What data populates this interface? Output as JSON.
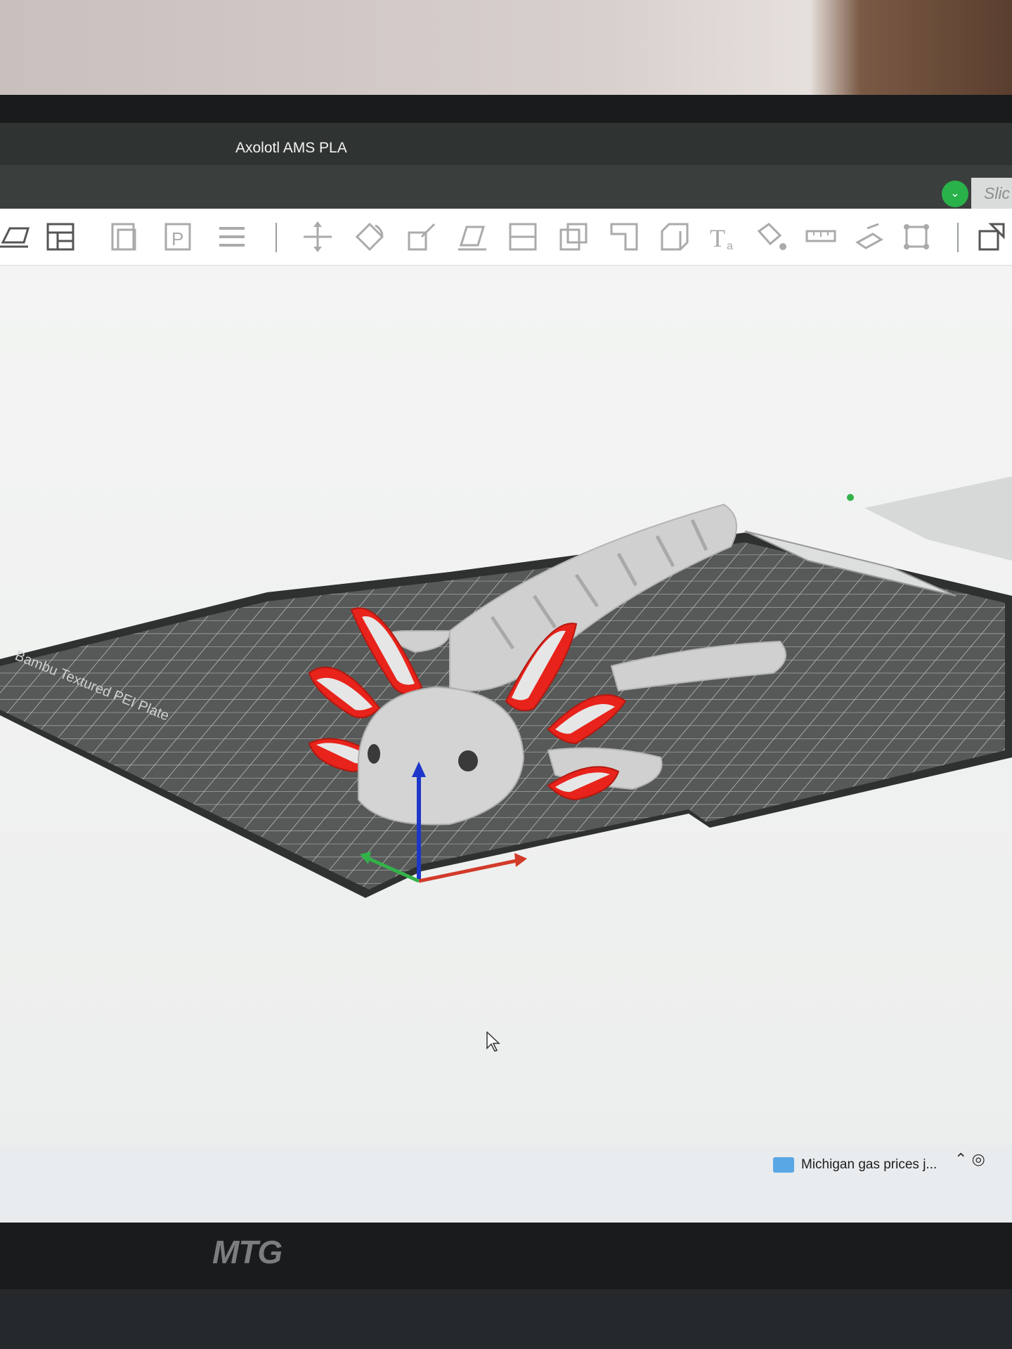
{
  "window": {
    "title": "Axolotl AMS  PLA"
  },
  "header": {
    "slice_label": "Slic",
    "slice_toggle_icon": "chevron-down-icon"
  },
  "toolbar": {
    "icons": [
      "add-plate-icon",
      "arrange-icon",
      "orient-icon",
      "plate-p-icon",
      "layers-icon",
      "move-icon",
      "rotate-icon",
      "scale-icon",
      "lay-on-face-icon",
      "cut-icon",
      "boolean-icon",
      "support-paint-icon",
      "split-icon",
      "text-icon",
      "color-paint-icon",
      "measure-icon",
      "assembly-icon",
      "fit-icon",
      "view-icon"
    ]
  },
  "plate": {
    "label": "Bambu Textured PEI Plate"
  },
  "model": {
    "name": "Axolotl",
    "body_color": "#cfcfcf",
    "gill_color": "#e8231b"
  },
  "axes": {
    "x_color": "#d23a2a",
    "y_color": "#33b24a",
    "z_color": "#1d36c9"
  },
  "taskbar": {
    "news_text": "Michigan gas prices j..."
  },
  "monitor": {
    "brand": "MTG"
  }
}
